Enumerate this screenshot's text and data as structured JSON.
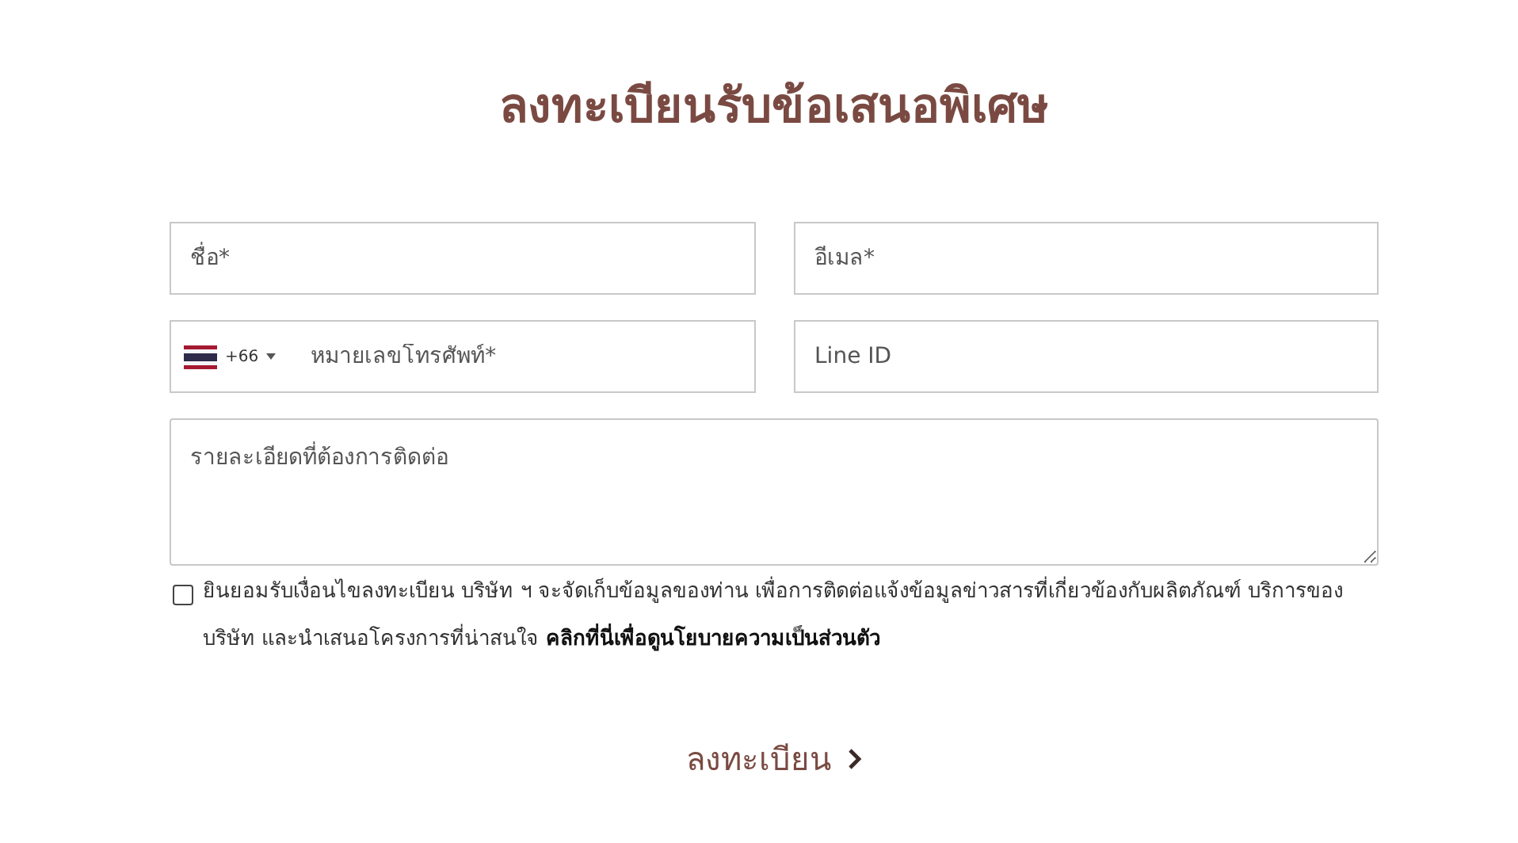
{
  "title": "ลงทะเบียนรับข้อเสนอพิเศษ",
  "fields": [
    {
      "kind": "text",
      "placeholder": "ชื่อ*"
    },
    {
      "kind": "text",
      "placeholder": "อีเมล*"
    },
    {
      "kind": "phone",
      "code": "+66",
      "placeholder": "หมายเลขโทรศัพท์*"
    },
    {
      "kind": "text",
      "placeholder": "Line ID"
    },
    {
      "kind": "textarea",
      "placeholder": "รายละเอียดที่ต้องการติดต่อ"
    }
  ],
  "consent": {
    "checked": false,
    "text": "ยินยอมรับเงื่อนไขลงทะเบียน บริษัท ฯ จะจัดเก็บข้อมูลของท่าน เพื่อการติดต่อแจ้งข้อมูลข่าวสารที่เกี่ยวข้องกับผลิตภัณฑ์ บริการของบริษัท และนำเสนอโครงการที่น่าสนใจ",
    "link": "คลิกที่นี่เพื่อดูนโยบายความเป็นส่วนตัว"
  },
  "submit": {
    "label": "ลงทะเบียน"
  }
}
